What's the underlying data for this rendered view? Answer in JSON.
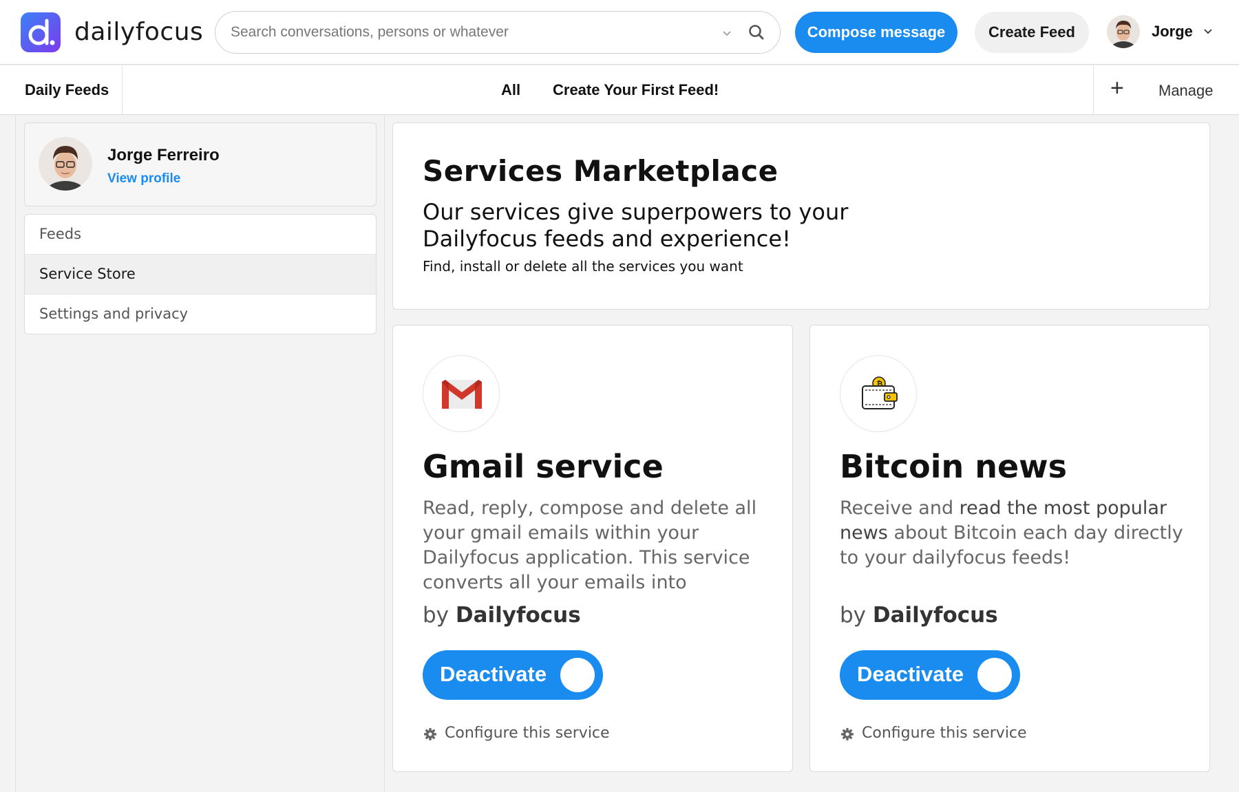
{
  "app": {
    "name": "dailyfocus",
    "logo_letter": "d."
  },
  "search": {
    "placeholder": "Search conversations, persons or whatever",
    "value": ""
  },
  "header": {
    "compose_label": "Compose message",
    "create_feed_label": "Create Feed",
    "user_name": "Jorge"
  },
  "subnav": {
    "section_label": "Daily Feeds",
    "tabs": [
      {
        "label": "All"
      },
      {
        "label": "Create Your First Feed!"
      }
    ],
    "add_icon": "+",
    "manage_label": "Manage"
  },
  "profile": {
    "name": "Jorge Ferreiro",
    "link_label": "View profile"
  },
  "sidebar": {
    "items": [
      {
        "label": "Feeds",
        "active": false
      },
      {
        "label": "Service Store",
        "active": true
      },
      {
        "label": "Settings and privacy",
        "active": false
      }
    ]
  },
  "hero": {
    "title": "Services Marketplace",
    "subtitle": "Our services give superpowers to your Dailyfocus feeds and experience!",
    "description": "Find, install or delete all the services you want"
  },
  "services": [
    {
      "title": "Gmail service",
      "icon": "gmail-icon",
      "description": "Read, reply, compose and delete all your gmail emails within your Dailyfocus application. This service converts all your emails into beautiful chats (like",
      "by_prefix": "by",
      "author": "Dailyfocus",
      "toggle_label": "Deactivate",
      "configure_label": "Configure this service"
    },
    {
      "title": "Bitcoin news",
      "icon": "bitcoin-wallet-icon",
      "description_parts": [
        "Receive and ",
        "read the most popular news",
        " about Bitcoin each day directly to your dailyfocus feeds!"
      ],
      "by_prefix": "by",
      "author": "Dailyfocus",
      "toggle_label": "Deactivate",
      "configure_label": "Configure this service"
    }
  ],
  "colors": {
    "accent": "#1a8cf0",
    "logo_gradient_start": "#3b82f6",
    "logo_gradient_end": "#7c3aed",
    "gmail_red": "#d2372b",
    "bitcoin_yellow": "#f5c400"
  }
}
